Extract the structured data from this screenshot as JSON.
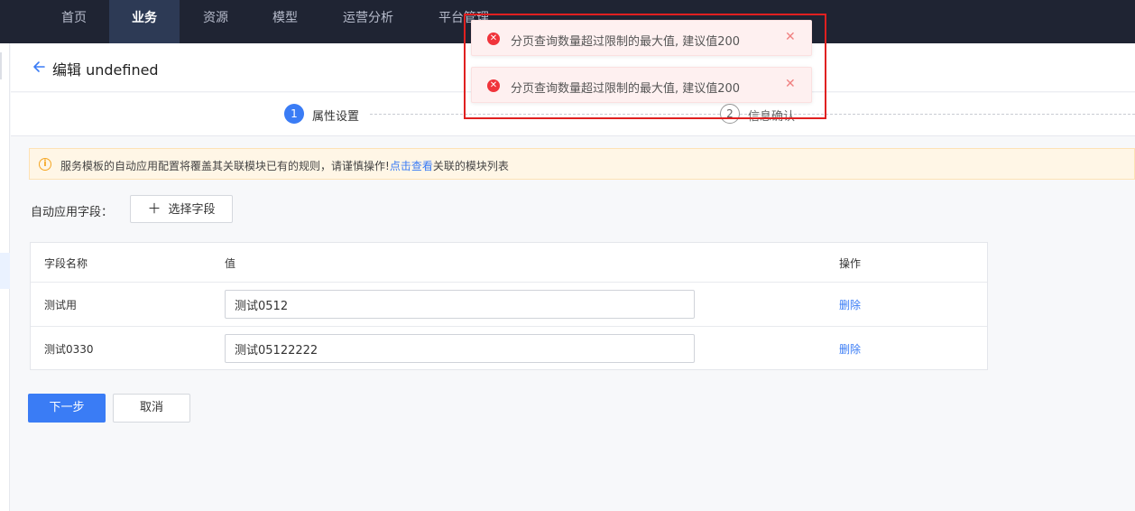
{
  "nav": {
    "items": [
      "首页",
      "业务",
      "资源",
      "模型",
      "运营分析",
      "平台管理"
    ],
    "active_index": 1
  },
  "header": {
    "title": "编辑 undefined"
  },
  "steps": [
    {
      "number": "1",
      "label": "属性设置",
      "active": true
    },
    {
      "number": "2",
      "label": "信息确认",
      "active": false
    }
  ],
  "warning": {
    "text": "服务模板的自动应用配置将覆盖其关联模块已有的规则，请谨慎操作!",
    "link_text": "点击查看",
    "text_after": "关联的模块列表"
  },
  "field": {
    "label": "自动应用字段：",
    "select_button": "选择字段"
  },
  "table": {
    "headers": [
      "字段名称",
      "值",
      "操作"
    ],
    "rows": [
      {
        "name": "测试用",
        "value": "测试0512",
        "action": "删除"
      },
      {
        "name": "测试0330",
        "value": "测试05122222",
        "action": "删除"
      }
    ]
  },
  "actions": {
    "next": "下一步",
    "cancel": "取消"
  },
  "toasts": [
    {
      "message": "分页查询数量超过限制的最大值, 建议值200"
    },
    {
      "message": "分页查询数量超过限制的最大值, 建议值200"
    }
  ],
  "colors": {
    "nav_bg": "#1f2433",
    "primary": "#3a7cf5",
    "error": "#f0343b",
    "warning": "#f5a623",
    "highlight": "#e02020"
  }
}
